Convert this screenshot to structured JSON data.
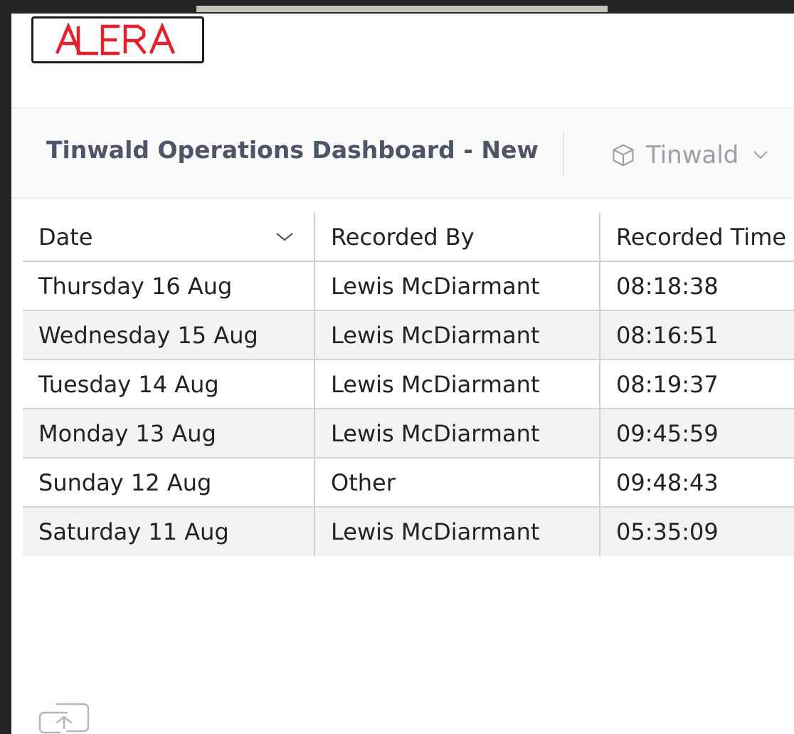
{
  "app": {
    "logo_text": "ALERA",
    "brand_color": "#e3222b"
  },
  "toolbar": {
    "title": "Tinwald Operations Dashboard - New",
    "site_selector": {
      "value": "Tinwald",
      "icon": "cube-icon",
      "chevron": "chevron-down-icon"
    }
  },
  "table": {
    "columns": [
      "Date",
      "Recorded By",
      "Recorded Time"
    ],
    "sort_icon": "chevron-down-icon",
    "rows": [
      [
        "Thursday 16 Aug",
        "Lewis McDiarmant",
        "08:18:38"
      ],
      [
        "Wednesday 15 Aug",
        "Lewis McDiarmant",
        "08:16:51"
      ],
      [
        "Tuesday 14 Aug",
        "Lewis McDiarmant",
        "08:19:37"
      ],
      [
        "Monday 13 Aug",
        "Lewis McDiarmant",
        "09:45:59"
      ],
      [
        "Sunday 12 Aug",
        "Other",
        "09:48:43"
      ],
      [
        "Saturday 11 Aug",
        "Lewis McDiarmant",
        "05:35:09"
      ]
    ]
  },
  "footer": {
    "share_icon": "share-link-icon"
  }
}
